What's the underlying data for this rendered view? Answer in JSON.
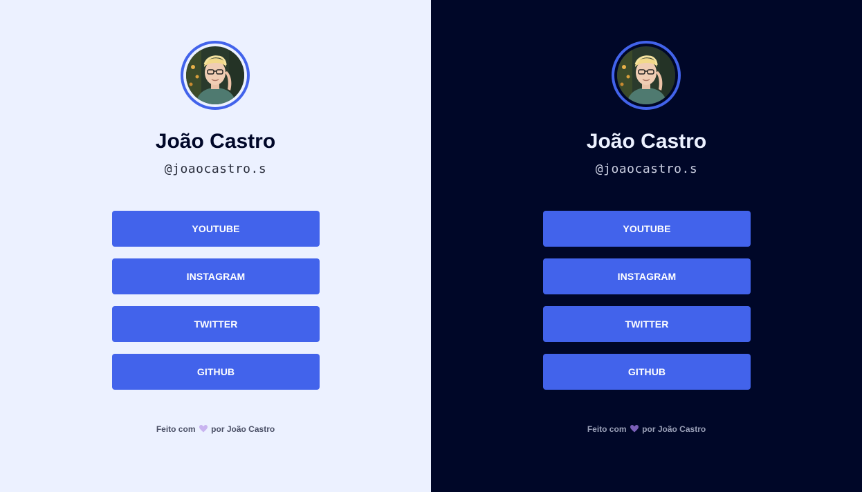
{
  "colors": {
    "light_background": "#ECF1FF",
    "dark_background": "#000728",
    "accent": "#4263EB",
    "button_text": "#FFFFFF",
    "heart_light": "#C9B4F0",
    "heart_dark": "#7A5FB8"
  },
  "panels": [
    {
      "theme": "light",
      "profile": {
        "name": "João Castro",
        "handle": "@joaocastro.s",
        "avatar_icon": "profile-photo"
      },
      "links": [
        {
          "label": "YOUTUBE"
        },
        {
          "label": "INSTAGRAM"
        },
        {
          "label": "TWITTER"
        },
        {
          "label": "GITHUB"
        }
      ],
      "footer": {
        "prefix": "Feito com",
        "icon": "heart-icon",
        "suffix": "por João Castro"
      }
    },
    {
      "theme": "dark",
      "profile": {
        "name": "João Castro",
        "handle": "@joaocastro.s",
        "avatar_icon": "profile-photo"
      },
      "links": [
        {
          "label": "YOUTUBE"
        },
        {
          "label": "INSTAGRAM"
        },
        {
          "label": "TWITTER"
        },
        {
          "label": "GITHUB"
        }
      ],
      "footer": {
        "prefix": "Feito com",
        "icon": "heart-icon",
        "suffix": "por João Castro"
      }
    }
  ]
}
